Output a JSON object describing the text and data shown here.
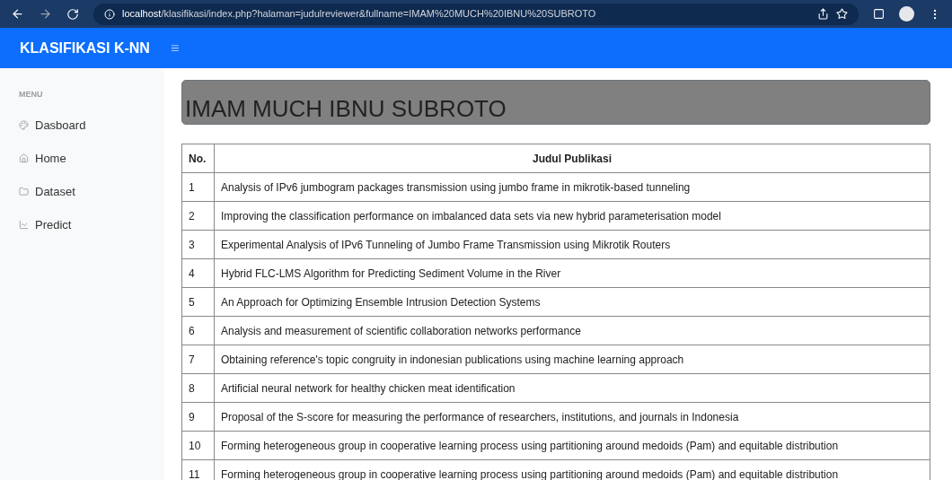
{
  "browser": {
    "url_host": "localhost",
    "url_path": "/klasifikasi/index.php?halaman=judulreviewer&fullname=IMAM%20MUCH%20IBNU%20SUBROTO"
  },
  "navbar": {
    "brand": "KLASIFIKASI K-NN",
    "menu_toggle": "≡"
  },
  "sidebar": {
    "heading": "MENU",
    "items": [
      {
        "label": "Dasboard"
      },
      {
        "label": "Home"
      },
      {
        "label": "Dataset"
      },
      {
        "label": "Predict"
      }
    ]
  },
  "page_title": "IMAM MUCH IBNU SUBROTO",
  "table": {
    "columns": [
      "No.",
      "Judul Publikasi"
    ],
    "rows": [
      [
        "1",
        "Analysis of IPv6 jumbogram packages transmission using jumbo frame in mikrotik-based tunneling"
      ],
      [
        "2",
        "Improving the classification performance on imbalanced data sets via new hybrid parameterisation model"
      ],
      [
        "3",
        "Experimental Analysis of IPv6 Tunneling of Jumbo Frame Transmission using Mikrotik Routers"
      ],
      [
        "4",
        "Hybrid FLC-LMS Algorithm for Predicting Sediment Volume in the River"
      ],
      [
        "5",
        "An Approach for Optimizing Ensemble Intrusion Detection Systems"
      ],
      [
        "6",
        "Analysis and measurement of scientific collaboration networks performance"
      ],
      [
        "7",
        "Obtaining reference's topic congruity in indonesian publications using machine learning approach"
      ],
      [
        "8",
        "Artificial neural network for healthy chicken meat identification"
      ],
      [
        "9",
        "Proposal of the S-score for measuring the performance of researchers, institutions, and journals in Indonesia"
      ],
      [
        "10",
        "Forming heterogeneous group in cooperative learning process using partitioning around medoids (Pam) and equitable distribution"
      ],
      [
        "11",
        "Forming heterogeneous group in cooperative learning process using partitioning around medoids (Pam) and equitable distribution"
      ]
    ]
  }
}
